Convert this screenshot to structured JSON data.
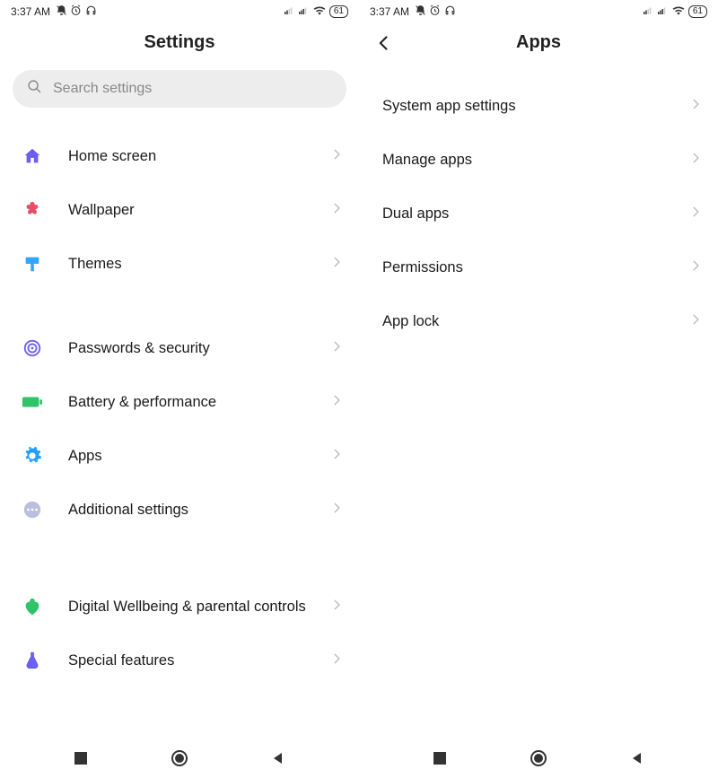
{
  "status": {
    "time": "3:37 AM",
    "battery": "61"
  },
  "left": {
    "title": "Settings",
    "search_placeholder": "Search settings",
    "items": [
      {
        "id": "home-screen",
        "label": "Home screen",
        "icon": "home",
        "color": "#6b5ef0"
      },
      {
        "id": "wallpaper",
        "label": "Wallpaper",
        "icon": "flower",
        "color": "#e84c68"
      },
      {
        "id": "themes",
        "label": "Themes",
        "icon": "brush",
        "color": "#33a7ff"
      }
    ],
    "items2": [
      {
        "id": "passwords-security",
        "label": "Passwords & security",
        "icon": "fingerprint",
        "color": "#6b5ef0"
      },
      {
        "id": "battery-perf",
        "label": "Battery & performance",
        "icon": "battery",
        "color": "#2ec46a"
      },
      {
        "id": "apps",
        "label": "Apps",
        "icon": "gear",
        "color": "#1ea0ff"
      },
      {
        "id": "additional",
        "label": "Additional settings",
        "icon": "dots",
        "color": "#bdbde0"
      }
    ],
    "items3": [
      {
        "id": "digital-wellbeing",
        "label": "Digital Wellbeing & parental controls",
        "icon": "heart",
        "color": "#2ec46a"
      },
      {
        "id": "special",
        "label": "Special features",
        "icon": "flask",
        "color": "#6b5ef0"
      }
    ]
  },
  "right": {
    "title": "Apps",
    "items": [
      {
        "id": "system-app-settings",
        "label": "System app settings"
      },
      {
        "id": "manage-apps",
        "label": "Manage apps"
      },
      {
        "id": "dual-apps",
        "label": "Dual apps"
      },
      {
        "id": "permissions",
        "label": "Permissions"
      },
      {
        "id": "app-lock",
        "label": "App lock"
      }
    ]
  }
}
